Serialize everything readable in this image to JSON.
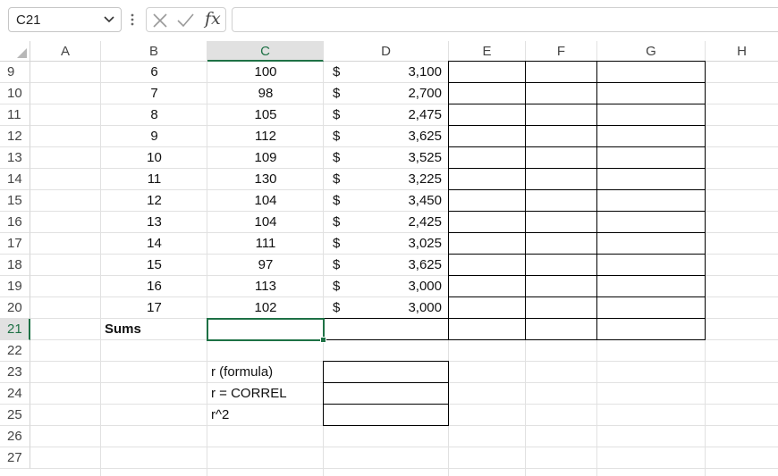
{
  "formula_bar": {
    "name_box": "C21",
    "formula": ""
  },
  "icons": {
    "name_box_dropdown": "chevron-down-icon",
    "cancel": "cancel-x-icon",
    "enter": "checkmark-icon",
    "insert_function": "fx"
  },
  "columns": [
    "A",
    "B",
    "C",
    "D",
    "E",
    "F",
    "G",
    "H"
  ],
  "rows": [
    {
      "num": "9",
      "b": "6",
      "c": "100",
      "d_sym": "$",
      "d": "3,100"
    },
    {
      "num": "10",
      "b": "7",
      "c": "98",
      "d_sym": "$",
      "d": "2,700"
    },
    {
      "num": "11",
      "b": "8",
      "c": "105",
      "d_sym": "$",
      "d": "2,475"
    },
    {
      "num": "12",
      "b": "9",
      "c": "112",
      "d_sym": "$",
      "d": "3,625"
    },
    {
      "num": "13",
      "b": "10",
      "c": "109",
      "d_sym": "$",
      "d": "3,525"
    },
    {
      "num": "14",
      "b": "11",
      "c": "130",
      "d_sym": "$",
      "d": "3,225"
    },
    {
      "num": "15",
      "b": "12",
      "c": "104",
      "d_sym": "$",
      "d": "3,450"
    },
    {
      "num": "16",
      "b": "13",
      "c": "104",
      "d_sym": "$",
      "d": "2,425"
    },
    {
      "num": "17",
      "b": "14",
      "c": "111",
      "d_sym": "$",
      "d": "3,025"
    },
    {
      "num": "18",
      "b": "15",
      "c": "97",
      "d_sym": "$",
      "d": "3,625"
    },
    {
      "num": "19",
      "b": "16",
      "c": "113",
      "d_sym": "$",
      "d": "3,000"
    },
    {
      "num": "20",
      "b": "17",
      "c": "102",
      "d_sym": "$",
      "d": "3,000"
    },
    {
      "num": "21",
      "b": "Sums"
    },
    {
      "num": "22"
    },
    {
      "num": "23",
      "c": "r (formula)"
    },
    {
      "num": "24",
      "c": "r = CORREL"
    },
    {
      "num": "25",
      "c": "r^2"
    },
    {
      "num": "26"
    },
    {
      "num": "27"
    }
  ],
  "selection": {
    "column": "C",
    "row": "21"
  },
  "colors": {
    "accent": "#1e7145",
    "gridline": "#e1e1e1",
    "header_selected": "#e1e1e1"
  }
}
